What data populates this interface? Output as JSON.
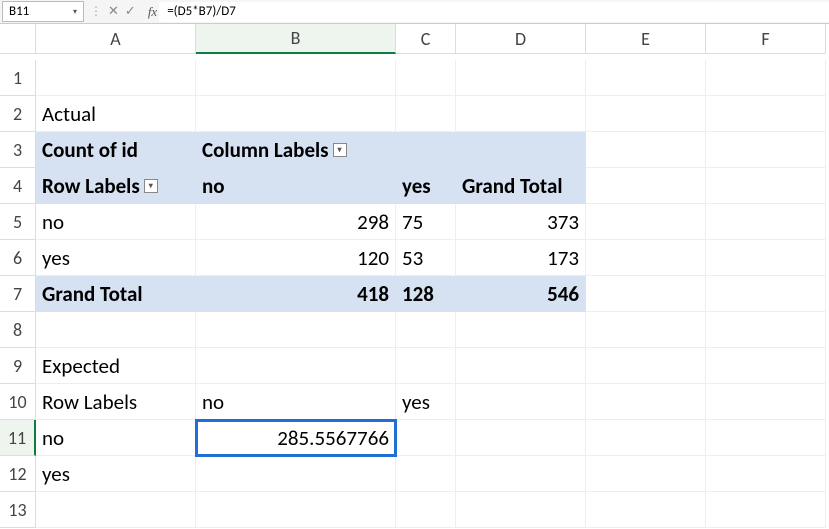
{
  "formula_bar": {
    "name_box": "B11",
    "formula": "=(D5*B7)/D7"
  },
  "columns": [
    "A",
    "B",
    "C",
    "D",
    "E",
    "F"
  ],
  "rows": [
    "1",
    "2",
    "3",
    "4",
    "5",
    "6",
    "7",
    "8",
    "9",
    "10",
    "11",
    "12",
    "13"
  ],
  "cells": {
    "A2": "Actual",
    "A3": "Count of id",
    "B3": "Column Labels",
    "A4": "Row Labels",
    "B4": "no",
    "C4": "yes",
    "D4": "Grand Total",
    "A5": "no",
    "B5": "298",
    "C5": "75",
    "D5": "373",
    "A6": "yes",
    "B6": "120",
    "C6": "53",
    "D6": "173",
    "A7": "Grand Total",
    "B7": "418",
    "C7": "128",
    "D7": "546",
    "A9": "Expected",
    "A10": "Row Labels",
    "B10": "no",
    "C10": "yes",
    "A11": "no",
    "B11": "285.5567766",
    "A12": "yes"
  },
  "icons": {
    "dropdown": "▾",
    "cancel": "✕",
    "enter": "✓",
    "fx": "fx"
  },
  "chart_data": {
    "type": "table",
    "title": "Actual: Count of id",
    "row_field": "Row Labels",
    "col_field": "Column Labels",
    "columns": [
      "no",
      "yes",
      "Grand Total"
    ],
    "rows": [
      {
        "label": "no",
        "values": [
          298,
          75,
          373
        ]
      },
      {
        "label": "yes",
        "values": [
          120,
          53,
          173
        ]
      },
      {
        "label": "Grand Total",
        "values": [
          418,
          128,
          546
        ]
      }
    ],
    "expected": {
      "rows": [
        "no",
        "yes"
      ],
      "columns": [
        "no",
        "yes"
      ],
      "values": [
        [
          285.5567766,
          null
        ],
        [
          null,
          null
        ]
      ],
      "formula_B11": "=(D5*B7)/D7"
    }
  }
}
